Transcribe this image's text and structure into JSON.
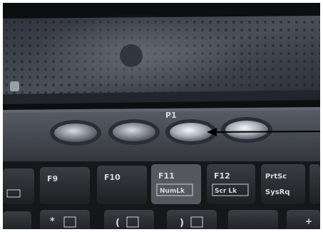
{
  "scene": {
    "description_free": true,
    "accent_colors": {
      "speaker_panel": "#3a3f48",
      "button_strip": "#4a4f57",
      "key_dark": "#2a2c30",
      "arrow": "#000000"
    }
  },
  "button_strip": {
    "labels": [
      "",
      "",
      "P1",
      ""
    ]
  },
  "keyboard": {
    "row1": [
      {
        "main": "F9",
        "sub": ""
      },
      {
        "main": "F10",
        "sub": ""
      },
      {
        "main": "F11",
        "sub": "NumLk"
      },
      {
        "main": "F12",
        "sub": "Scr Lk"
      },
      {
        "main": "PrtSc",
        "sub": "SysRq"
      }
    ],
    "row2": [
      {
        "main": "*",
        "sub": ""
      },
      {
        "main": "(",
        "sub": ""
      },
      {
        "main": ")",
        "sub": ""
      },
      {
        "main": "+",
        "sub": ""
      }
    ]
  }
}
